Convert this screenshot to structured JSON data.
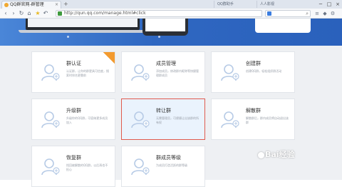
{
  "browser": {
    "tab_title": "QQ群官网-群管理",
    "tab_close": "×",
    "new_tab": "+",
    "ghost_tabs": [
      "QQ群助手",
      "人人影视"
    ],
    "url": "http://qun.qq.com/manage.html#click",
    "search_placeholder": "",
    "window_controls": [
      "─",
      "□",
      "×"
    ]
  },
  "cards": [
    {
      "title": "群认证",
      "desc": "认证群，让你的群更具可信度，搜索时排名更靠前",
      "selected": false,
      "ribbon": true
    },
    {
      "title": "成员管理",
      "desc": "添加成员，修改群内昵称等快捷管理群成员",
      "selected": false,
      "ribbon": false
    },
    {
      "title": "创建群",
      "desc": "创建QQ群，轻松组织群活动",
      "selected": false,
      "ribbon": false
    },
    {
      "title": "升级群",
      "desc": "升级你的QQ群，可容纳更多成员加入",
      "selected": false,
      "ribbon": false
    },
    {
      "title": "转让群",
      "desc": "无需管理员，可便捷让出该群的所有权",
      "selected": true,
      "ribbon": false
    },
    {
      "title": "解散群",
      "desc": "解散群后，群内成员将自动退出该群",
      "selected": false,
      "ribbon": false
    },
    {
      "title": "恢复群",
      "desc": "找回被解散的QQ群，以后再也不担心",
      "selected": false,
      "ribbon": false
    },
    {
      "title": "群成员等级",
      "desc": "为成员打造活跃的群等级",
      "selected": false,
      "ribbon": false
    }
  ],
  "watermark": "Bai经验",
  "colors": {
    "banner": "#2f67c1",
    "selected_border": "#e05a4e",
    "selected_bg": "#eaf3fd",
    "ribbon": "#f39a2e",
    "icon": "#b7cbe6"
  }
}
